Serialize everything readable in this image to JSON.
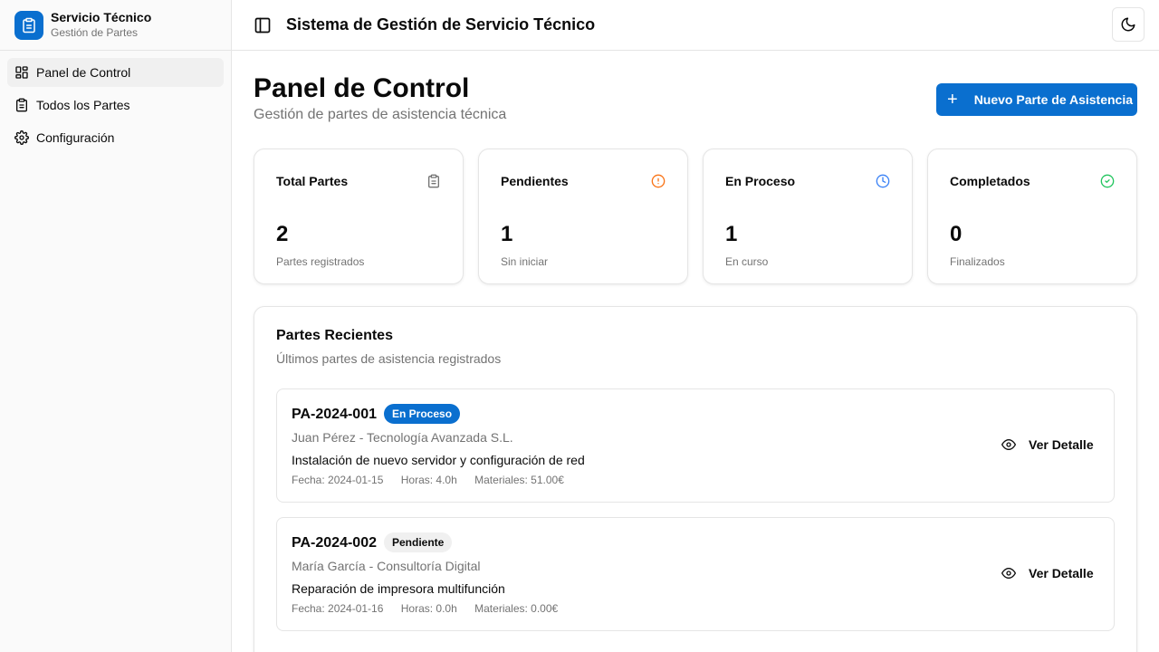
{
  "brand": {
    "title": "Servicio Técnico",
    "subtitle": "Gestión de Partes"
  },
  "sidebar": {
    "items": [
      {
        "label": "Panel de Control",
        "icon": "dashboard-icon",
        "active": true
      },
      {
        "label": "Todos los Partes",
        "icon": "clipboard-icon",
        "active": false
      },
      {
        "label": "Configuración",
        "icon": "gear-icon",
        "active": false
      }
    ]
  },
  "header": {
    "title": "Sistema de Gestión de Servicio Técnico",
    "theme_icon": "moon-icon",
    "toggle_icon": "sidebar-toggle-icon"
  },
  "page": {
    "title": "Panel de Control",
    "subtitle": "Gestión de partes de asistencia técnica",
    "new_button": "Nuevo Parte de Asistencia",
    "new_button_symbol": "+"
  },
  "stats": [
    {
      "label": "Total Partes",
      "value": "2",
      "desc": "Partes registrados",
      "icon": "clipboard-icon",
      "color": "#737373"
    },
    {
      "label": "Pendientes",
      "value": "1",
      "desc": "Sin iniciar",
      "icon": "alert-circle-icon",
      "color": "#f97316"
    },
    {
      "label": "En Proceso",
      "value": "1",
      "desc": "En curso",
      "icon": "clock-icon",
      "color": "#3b82f6"
    },
    {
      "label": "Completados",
      "value": "0",
      "desc": "Finalizados",
      "icon": "check-circle-icon",
      "color": "#22c55e"
    }
  ],
  "recent": {
    "title": "Partes Recientes",
    "subtitle": "Últimos partes de asistencia registrados",
    "items": [
      {
        "code": "PA-2024-001",
        "status": "En Proceso",
        "client": "Juan Pérez - Tecnología Avanzada S.L.",
        "description": "Instalación de nuevo servidor y configuración de red",
        "date": "Fecha: 2024-01-15",
        "hours": "Horas: 4.0h",
        "materials": "Materiales: 51.00€",
        "action": "Ver Detalle"
      },
      {
        "code": "PA-2024-002",
        "status": "Pendiente",
        "client": "María García - Consultoría Digital",
        "description": "Reparación de impresora multifunción",
        "date": "Fecha: 2024-01-16",
        "hours": "Horas: 0.0h",
        "materials": "Materiales: 0.00€",
        "action": "Ver Detalle"
      }
    ]
  },
  "colors": {
    "accent": "#0a6fcf",
    "muted": "#737373",
    "border": "#e5e5e5"
  }
}
